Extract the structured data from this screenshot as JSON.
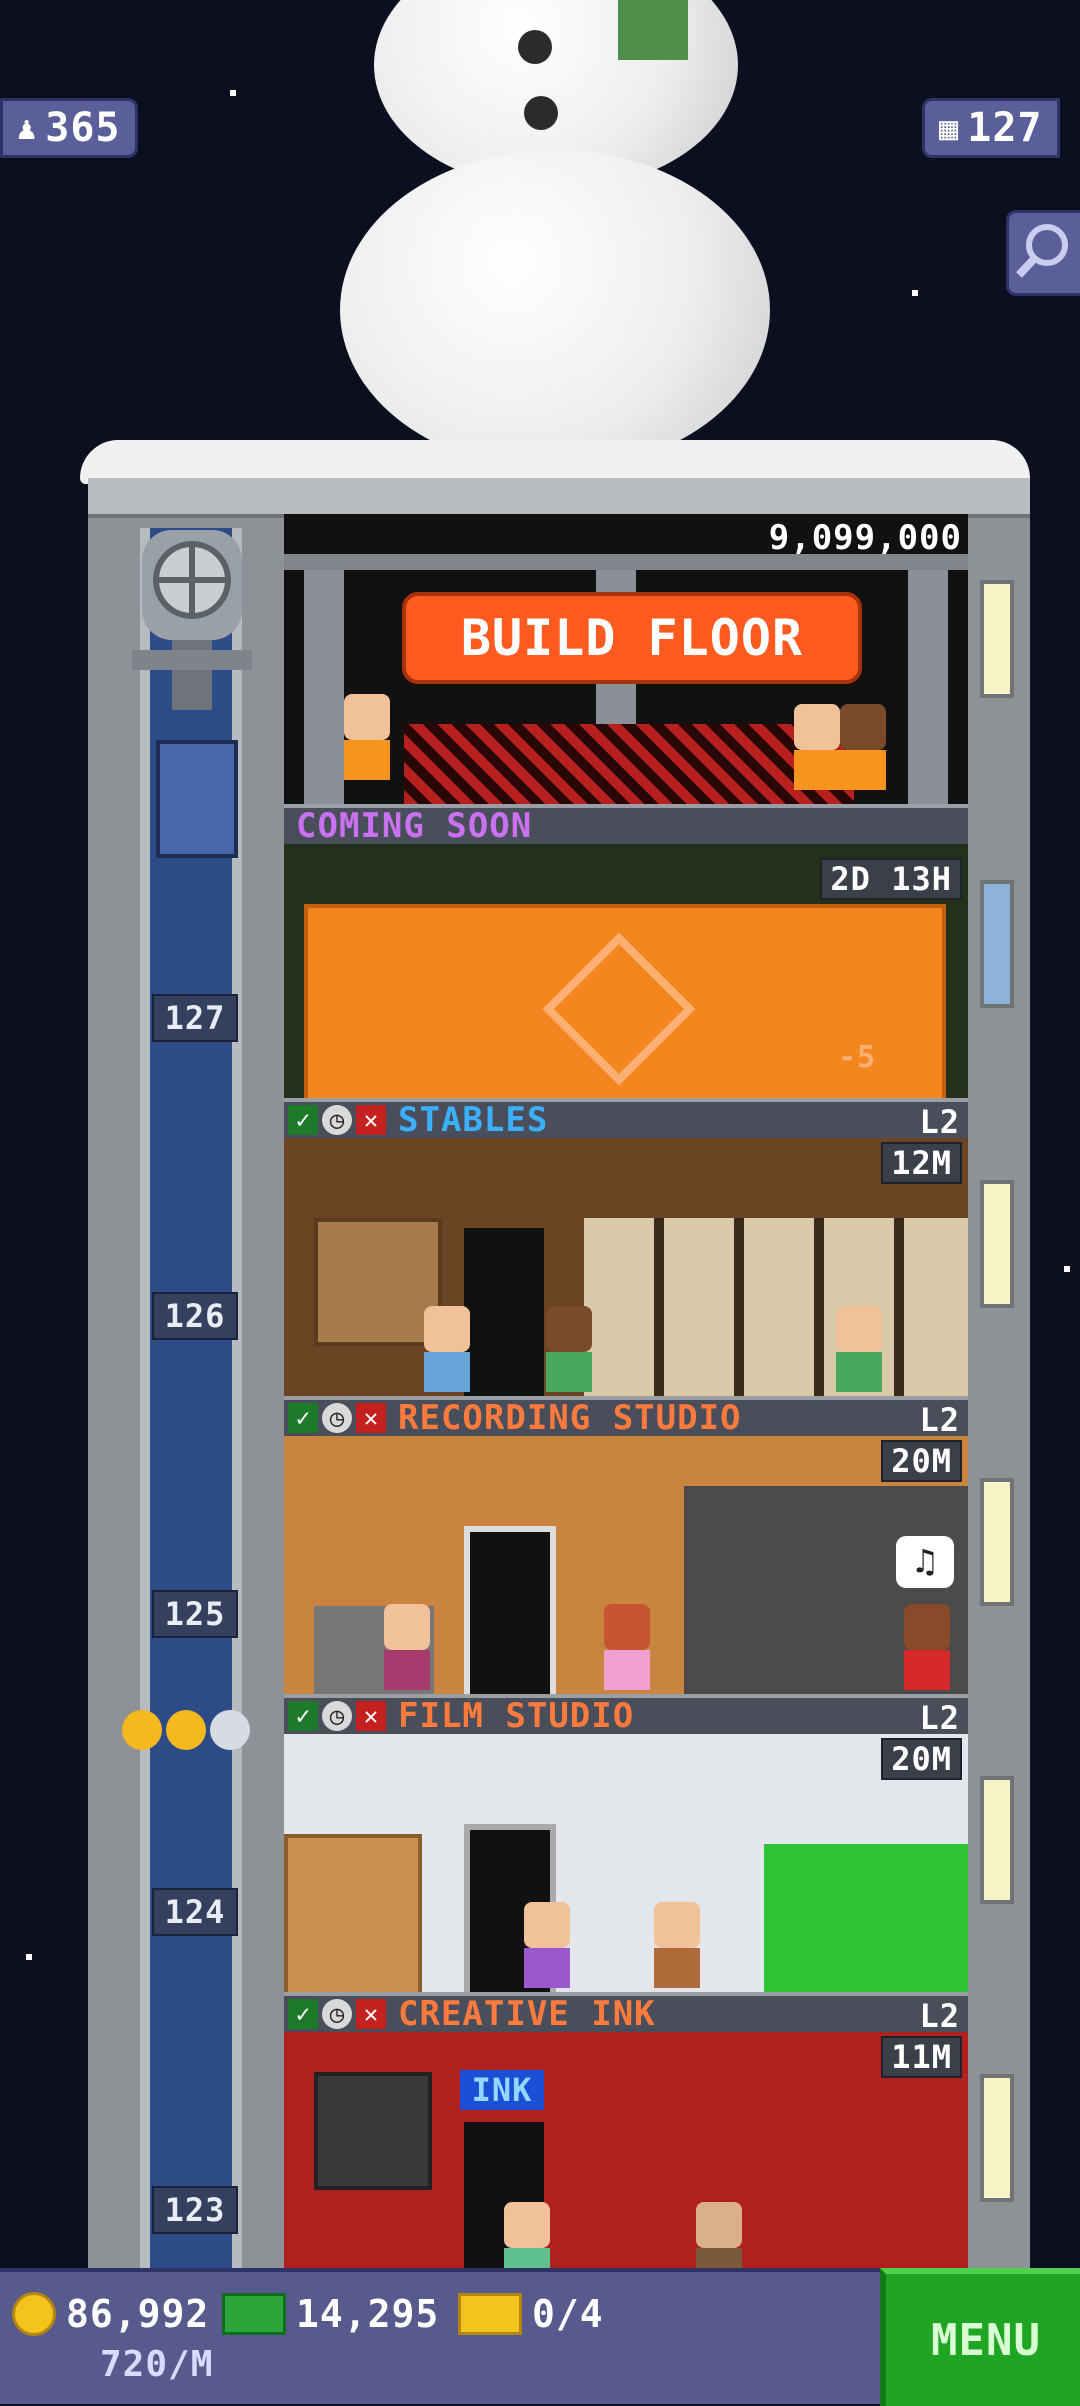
{
  "hud_top": {
    "population": "365",
    "population_icon": "person-icon",
    "floors": "127",
    "floors_icon": "building-icon",
    "search_icon": "magnifier-icon"
  },
  "build": {
    "cost": "9,099,000",
    "button_label": "BUILD FLOOR"
  },
  "construction": {
    "status": "COMING SOON",
    "timer": "2D 13H",
    "bonus": "-5"
  },
  "floors": [
    {
      "number": "127",
      "name": "STABLES",
      "level": "L2",
      "price": "12M",
      "title_color": "#3ab0ff"
    },
    {
      "number": "126",
      "name": "RECORDING STUDIO",
      "level": "L2",
      "price": "20M",
      "title_color": "#ff7a3d"
    },
    {
      "number": "125",
      "name": "FILM STUDIO",
      "level": "L2",
      "price": "20M",
      "title_color": "#ff7a3d"
    },
    {
      "number": "124",
      "name": "CREATIVE INK",
      "level": "L2",
      "price": "11M",
      "title_color": "#ff7a3d"
    },
    {
      "number": "123"
    }
  ],
  "floor_sign": "INK",
  "hud_bottom": {
    "coins": "86,992",
    "bux": "14,295",
    "tickets": "0/4",
    "rate": "720/M",
    "menu_label": "MENU"
  },
  "colors": {
    "sky": "#0b0f1f",
    "hud": "#575a8c",
    "menu": "#1fa424",
    "build_button": "#ff5a1f"
  }
}
